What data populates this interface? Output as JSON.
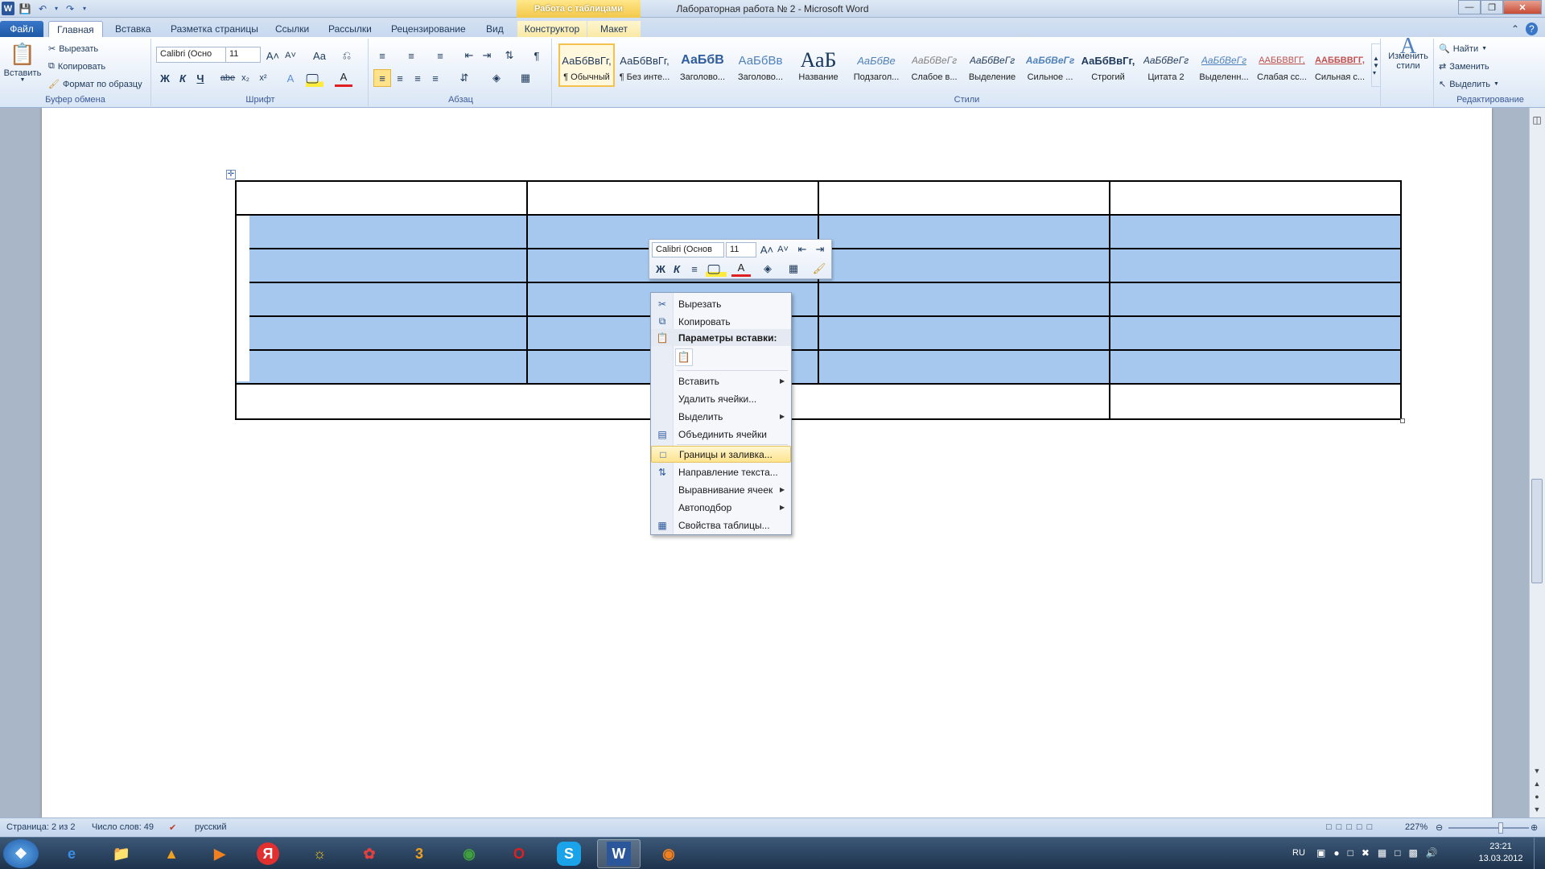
{
  "window": {
    "title": "Лабораторная работа № 2  -  Microsoft Word",
    "context_group": "Работа с таблицами",
    "app_icon": "W"
  },
  "tabs": [
    {
      "label": "Файл"
    },
    {
      "label": "Главная"
    },
    {
      "label": "Вставка"
    },
    {
      "label": "Разметка страницы"
    },
    {
      "label": "Ссылки"
    },
    {
      "label": "Рассылки"
    },
    {
      "label": "Рецензирование"
    },
    {
      "label": "Вид"
    },
    {
      "label": "Конструктор"
    },
    {
      "label": "Макет"
    }
  ],
  "clipboard": {
    "paste": "Вставить",
    "cut": "Вырезать",
    "copy": "Копировать",
    "format_painter": "Формат по образцу",
    "label": "Буфер обмена"
  },
  "font": {
    "name": "Calibri (Осно",
    "size": "11",
    "label": "Шрифт",
    "bold": "Ж",
    "italic": "К",
    "underline": "Ч",
    "strike": "abe",
    "aa": "Aa"
  },
  "paragraph": {
    "label": "Абзац",
    "pilcrow": "¶"
  },
  "styles": {
    "label": "Стили",
    "items": [
      {
        "sample": "АаБбВвГг,",
        "name": "¶ Обычный"
      },
      {
        "sample": "АаБбВвГг,",
        "name": "¶ Без инте..."
      },
      {
        "sample": "АаБбВ",
        "name": "Заголово..."
      },
      {
        "sample": "АаБбВв",
        "name": "Заголово..."
      },
      {
        "sample": "АаБ",
        "name": "Название"
      },
      {
        "sample": "АаБбВе",
        "name": "Подзагол..."
      },
      {
        "sample": "АаБбВеГг",
        "name": "Слабое в..."
      },
      {
        "sample": "АаБбВеГг",
        "name": "Выделение"
      },
      {
        "sample": "АаБбВеГг",
        "name": "Сильное ..."
      },
      {
        "sample": "АаБбВвГг,",
        "name": "Строгий"
      },
      {
        "sample": "АаБбВеГг",
        "name": "Цитата 2"
      },
      {
        "sample": "АаБбВеГг",
        "name": "Выделенн..."
      },
      {
        "sample": "ААББВВГГ,",
        "name": "Слабая сс..."
      },
      {
        "sample": "ААББВВГГ,",
        "name": "Сильная с..."
      }
    ],
    "change": "Изменить стили"
  },
  "editing": {
    "label": "Редактирование",
    "find": "Найти",
    "replace": "Заменить",
    "select": "Выделить"
  },
  "mini_toolbar": {
    "font": "Calibri (Основ",
    "size": "11"
  },
  "context_menu": [
    {
      "label": "Вырезать",
      "icon": "scissors-icon"
    },
    {
      "label": "Копировать",
      "icon": "copy-icon"
    },
    {
      "label": "Параметры вставки:",
      "icon": "clipboard-icon"
    },
    {
      "label": "Вставить",
      "icon": ""
    },
    {
      "label": "Удалить ячейки...",
      "icon": ""
    },
    {
      "label": "Выделить",
      "icon": ""
    },
    {
      "label": "Объединить ячейки",
      "icon": "merge-cells-icon"
    },
    {
      "label": "Границы и заливка...",
      "icon": "borders-icon"
    },
    {
      "label": "Направление текста...",
      "icon": "text-direction-icon"
    },
    {
      "label": "Выравнивание ячеек",
      "icon": ""
    },
    {
      "label": "Автоподбор",
      "icon": ""
    },
    {
      "label": "Свойства таблицы...",
      "icon": "table-properties-icon"
    }
  ],
  "status": {
    "page": "Страница: 2 из 2",
    "words": "Число слов: 49",
    "language": "русский",
    "zoom": "227%"
  },
  "taskbar": {
    "lang": "RU",
    "time": "23:21",
    "date": "13.03.2012"
  },
  "colors": {
    "selection": "#a6c8ee",
    "file_tab": "#2b579a",
    "context_group": "#f3c84a"
  }
}
